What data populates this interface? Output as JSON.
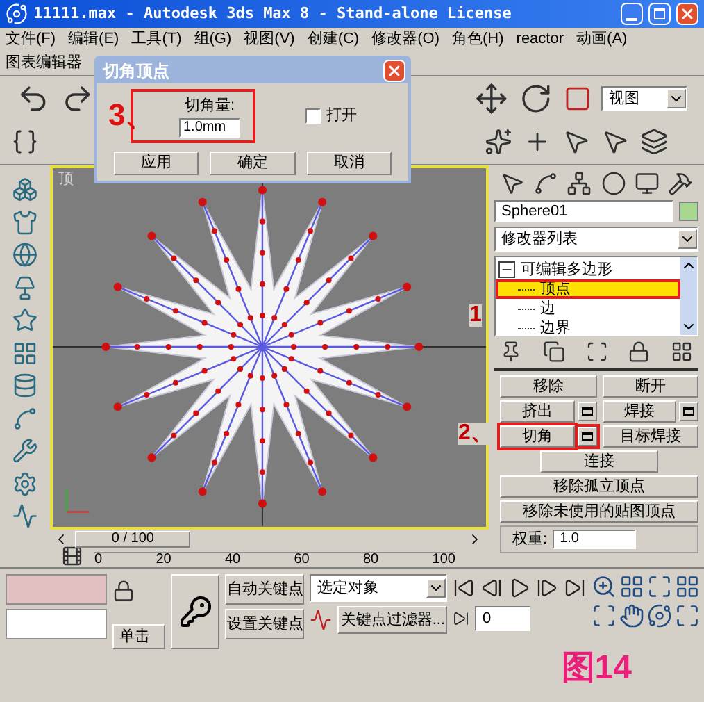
{
  "window": {
    "title": "11111.max - Autodesk 3ds Max 8  - Stand-alone License"
  },
  "menu": [
    "文件(F)",
    "编辑(E)",
    "工具(T)",
    "组(G)",
    "视图(V)",
    "创建(C)",
    "修改器(O)",
    "角色(H)",
    "reactor",
    "动画(A)",
    "图表编辑器"
  ],
  "toolbar": {
    "view_dropdown": "视图"
  },
  "viewport": {
    "label": "顶"
  },
  "time_slider": {
    "label": "0 / 100"
  },
  "ruler": {
    "ticks": [
      "0",
      "20",
      "40",
      "60",
      "80",
      "100"
    ]
  },
  "command_panel": {
    "object_name": "Sphere01",
    "modifier_list": "修改器列表",
    "note": "1",
    "stack": [
      {
        "label": "可编辑多边形",
        "expanded": true,
        "children": [
          {
            "label": "顶点",
            "selected": true
          },
          {
            "label": "边",
            "selected": false
          },
          {
            "label": "边界",
            "selected": false
          }
        ]
      }
    ],
    "edit_vertices": {
      "note": "2、",
      "buttons": [
        {
          "label": "移除",
          "kind": "half",
          "settings": false,
          "marked": false
        },
        {
          "label": "断开",
          "kind": "half",
          "settings": false,
          "marked": false
        },
        {
          "label": "挤出",
          "kind": "half",
          "settings": true,
          "marked": false
        },
        {
          "label": "焊接",
          "kind": "half",
          "settings": true,
          "marked": false
        },
        {
          "label": "切角",
          "kind": "half",
          "settings": true,
          "marked": true
        },
        {
          "label": "目标焊接",
          "kind": "half",
          "settings": false,
          "marked": false
        },
        {
          "label": "连接",
          "kind": "center",
          "settings": false,
          "marked": false
        },
        {
          "label": "移除孤立顶点",
          "kind": "full",
          "settings": false,
          "marked": false
        },
        {
          "label": "移除未使用的贴图顶点",
          "kind": "full",
          "settings": false,
          "marked": false
        }
      ],
      "weight_label": "权重:",
      "weight": "1.0"
    }
  },
  "status": {
    "prompt": "单击",
    "auto_key": "自动关键点",
    "set_key": "设置关键点",
    "selection": "选定对象",
    "key_filters": "关键点过滤器...",
    "frame": "0"
  },
  "figure_label": "图14",
  "dialog": {
    "title": "切角顶点",
    "note": "3、",
    "amount_label": "切角量:",
    "amount": "1.0mm",
    "open": {
      "label": "打开",
      "checked": false
    },
    "buttons": [
      "应用",
      "确定",
      "取消"
    ]
  }
}
